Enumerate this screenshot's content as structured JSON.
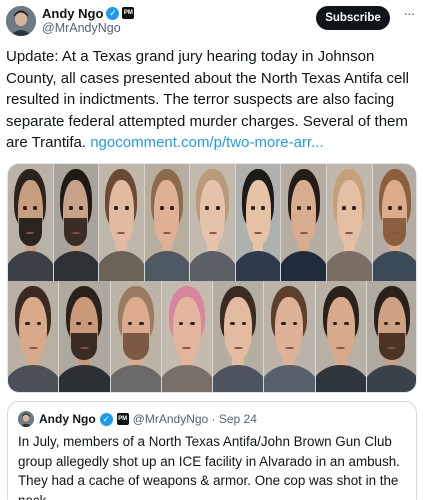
{
  "author": {
    "name": "Andy Ngo",
    "handle": "@MrAndyNgo",
    "badge_text": "PM"
  },
  "actions": {
    "subscribe_label": "Subscribe",
    "more_label": "···"
  },
  "tweet": {
    "text": "Update: At a Texas grand jury hearing today in Johnson County, all cases presented about the North Texas Antifa cell resulted in indictments. The terror suspects are also facing separate federal attempted murder charges. Several of them are Trantifa. ",
    "link": "ngocomment.com/p/two-more-arr..."
  },
  "media": {
    "row1": [
      {
        "bg": "#b9b2a6",
        "shirt": "#3b3f46",
        "skin": "#c79f7e",
        "hair": "#2a231e",
        "beard": "#2a231e"
      },
      {
        "bg": "#a9a49b",
        "shirt": "#2e3136",
        "skin": "#c8a286",
        "hair": "#201a16",
        "beard": "#3a2e24"
      },
      {
        "bg": "#bfb7aa",
        "shirt": "#6b6258",
        "skin": "#e2b9a1",
        "hair": "#6a4a33",
        "beard": ""
      },
      {
        "bg": "#b7aea0",
        "shirt": "#4e5a63",
        "skin": "#dfb093",
        "hair": "#8c6a4c",
        "beard": ""
      },
      {
        "bg": "#c2baae",
        "shirt": "#5b5f66",
        "skin": "#e6c2ab",
        "hair": "#b99b7a",
        "beard": ""
      },
      {
        "bg": "#aeb1ad",
        "shirt": "#2d3b4a",
        "skin": "#e6c3a5",
        "hair": "#1e1a18",
        "beard": ""
      },
      {
        "bg": "#b4ada3",
        "shirt": "#1f2c3b",
        "skin": "#d8ac8e",
        "hair": "#231d1a",
        "beard": ""
      },
      {
        "bg": "#c1b8ab",
        "shirt": "#7a6e64",
        "skin": "#e5bfa4",
        "hair": "#c2a17b",
        "beard": ""
      },
      {
        "bg": "#b2aca2",
        "shirt": "#3b4a57",
        "skin": "#dcab8a",
        "hair": "#8a5f3d",
        "beard": "#8a5f3d"
      }
    ],
    "row2": [
      {
        "bg": "#b8b0a3",
        "shirt": "#4b4f56",
        "skin": "#d9aa8a",
        "hair": "#3b2a20",
        "beard": ""
      },
      {
        "bg": "#aea89e",
        "shirt": "#2c3035",
        "skin": "#c89a78",
        "hair": "#2a211b",
        "beard": "#3a2c22"
      },
      {
        "bg": "#bcb4a6",
        "shirt": "#6c6a68",
        "skin": "#dcab8d",
        "hair": "#9b7b62",
        "beard": "#7b5b44"
      },
      {
        "bg": "#c2bbae",
        "shirt": "#7a6f68",
        "skin": "#e2b59c",
        "hair": "#d7869e",
        "beard": ""
      },
      {
        "bg": "#b3ada2",
        "shirt": "#4e5560",
        "skin": "#e3bba1",
        "hair": "#3b2c21",
        "beard": ""
      },
      {
        "bg": "#bbb3a7",
        "shirt": "#56606a",
        "skin": "#ddb297",
        "hair": "#5c402c",
        "beard": ""
      },
      {
        "bg": "#b7b0a5",
        "shirt": "#2e353d",
        "skin": "#d7aa8c",
        "hair": "#2a211b",
        "beard": ""
      },
      {
        "bg": "#afa99f",
        "shirt": "#3a424b",
        "skin": "#cfa183",
        "hair": "#2b2118",
        "beard": "#4b3424"
      }
    ]
  },
  "quote": {
    "name": "Andy Ngo",
    "badge_text": "PM",
    "handle_date": "@MrAndyNgo · Sep 24",
    "text": "In July, members of a North Texas Antifa/John Brown Gun Club group allegedly shot up an ICE facility in Alvarado in an ambush. They had a cache of weapons & armor. One cop was shot in the neck."
  }
}
